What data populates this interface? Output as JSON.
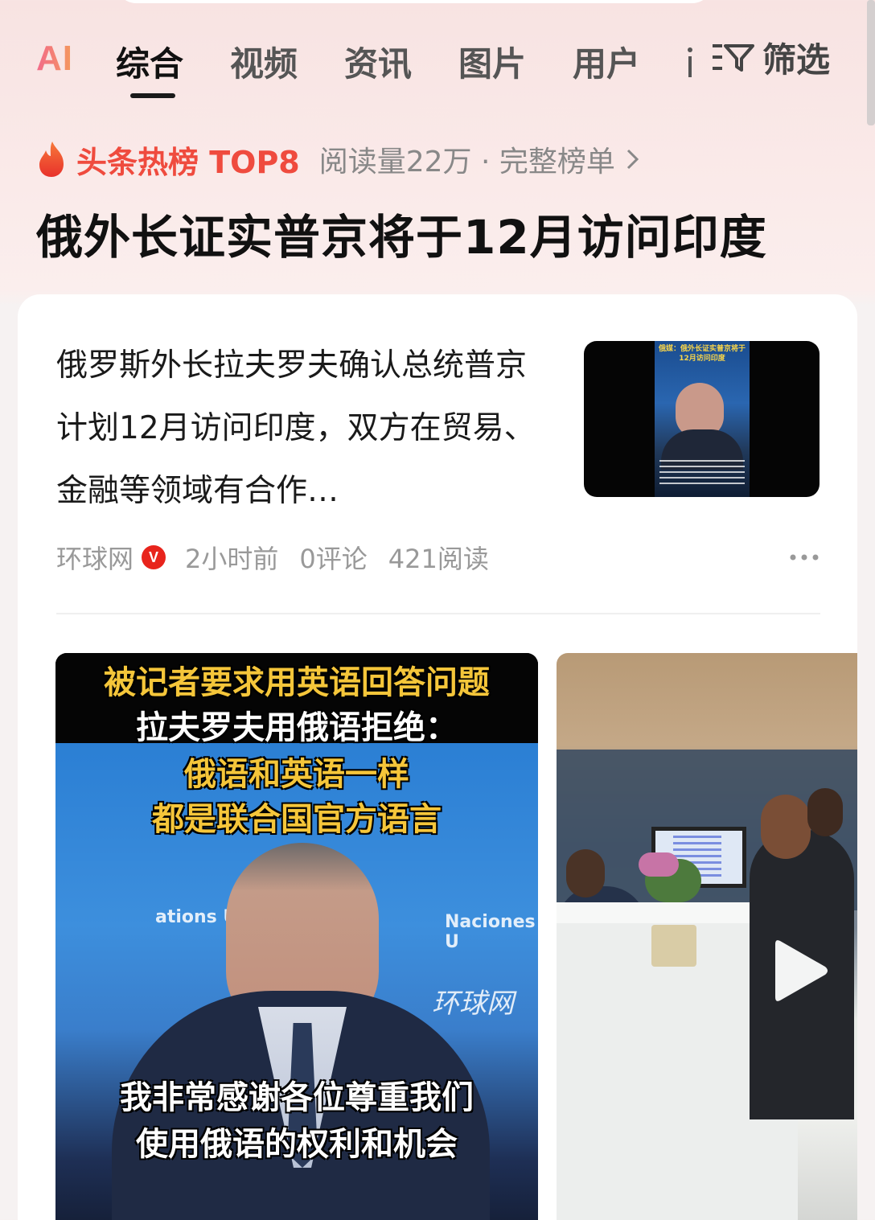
{
  "tabs": {
    "ai": "AI",
    "items": [
      {
        "label": "综合",
        "active": true
      },
      {
        "label": "视频",
        "active": false
      },
      {
        "label": "资讯",
        "active": false
      },
      {
        "label": "图片",
        "active": false
      },
      {
        "label": "用户",
        "active": false
      }
    ],
    "filter_label": "筛选"
  },
  "hot": {
    "label": "头条热榜 TOP8",
    "meta": "阅读量22万 · 完整榜单",
    "accent_color": "#ef4b3e"
  },
  "headline": "俄外长证实普京将于12月访问印度",
  "article": {
    "summary": "俄罗斯外长拉夫罗夫确认总统普京计划12月访问印度，双方在贸易、金融等领域有合作…",
    "thumbnail_caption": "俄媒：俄外长证实普京将于12月访问印度",
    "source": "环球网",
    "verified_badge": "V",
    "time": "2小时前",
    "comments": "0评论",
    "reads": "421阅读",
    "more_icon": "more-dots-icon"
  },
  "media": {
    "left": {
      "caption_top_line1": "被记者要求用英语回答问题",
      "caption_top_line2": "拉夫罗夫用俄语拒绝：",
      "caption_mid_line1": "俄语和英语一样",
      "caption_mid_line2": "都是联合国官方语言",
      "un_text_left": "ations U",
      "un_text_right": "Naciones U",
      "watermark": "环球网",
      "caption_bottom_line1": "我非常感谢各位尊重我们",
      "caption_bottom_line2": "使用俄语的权利和机会"
    },
    "right": {
      "play_icon": "play-icon"
    }
  }
}
